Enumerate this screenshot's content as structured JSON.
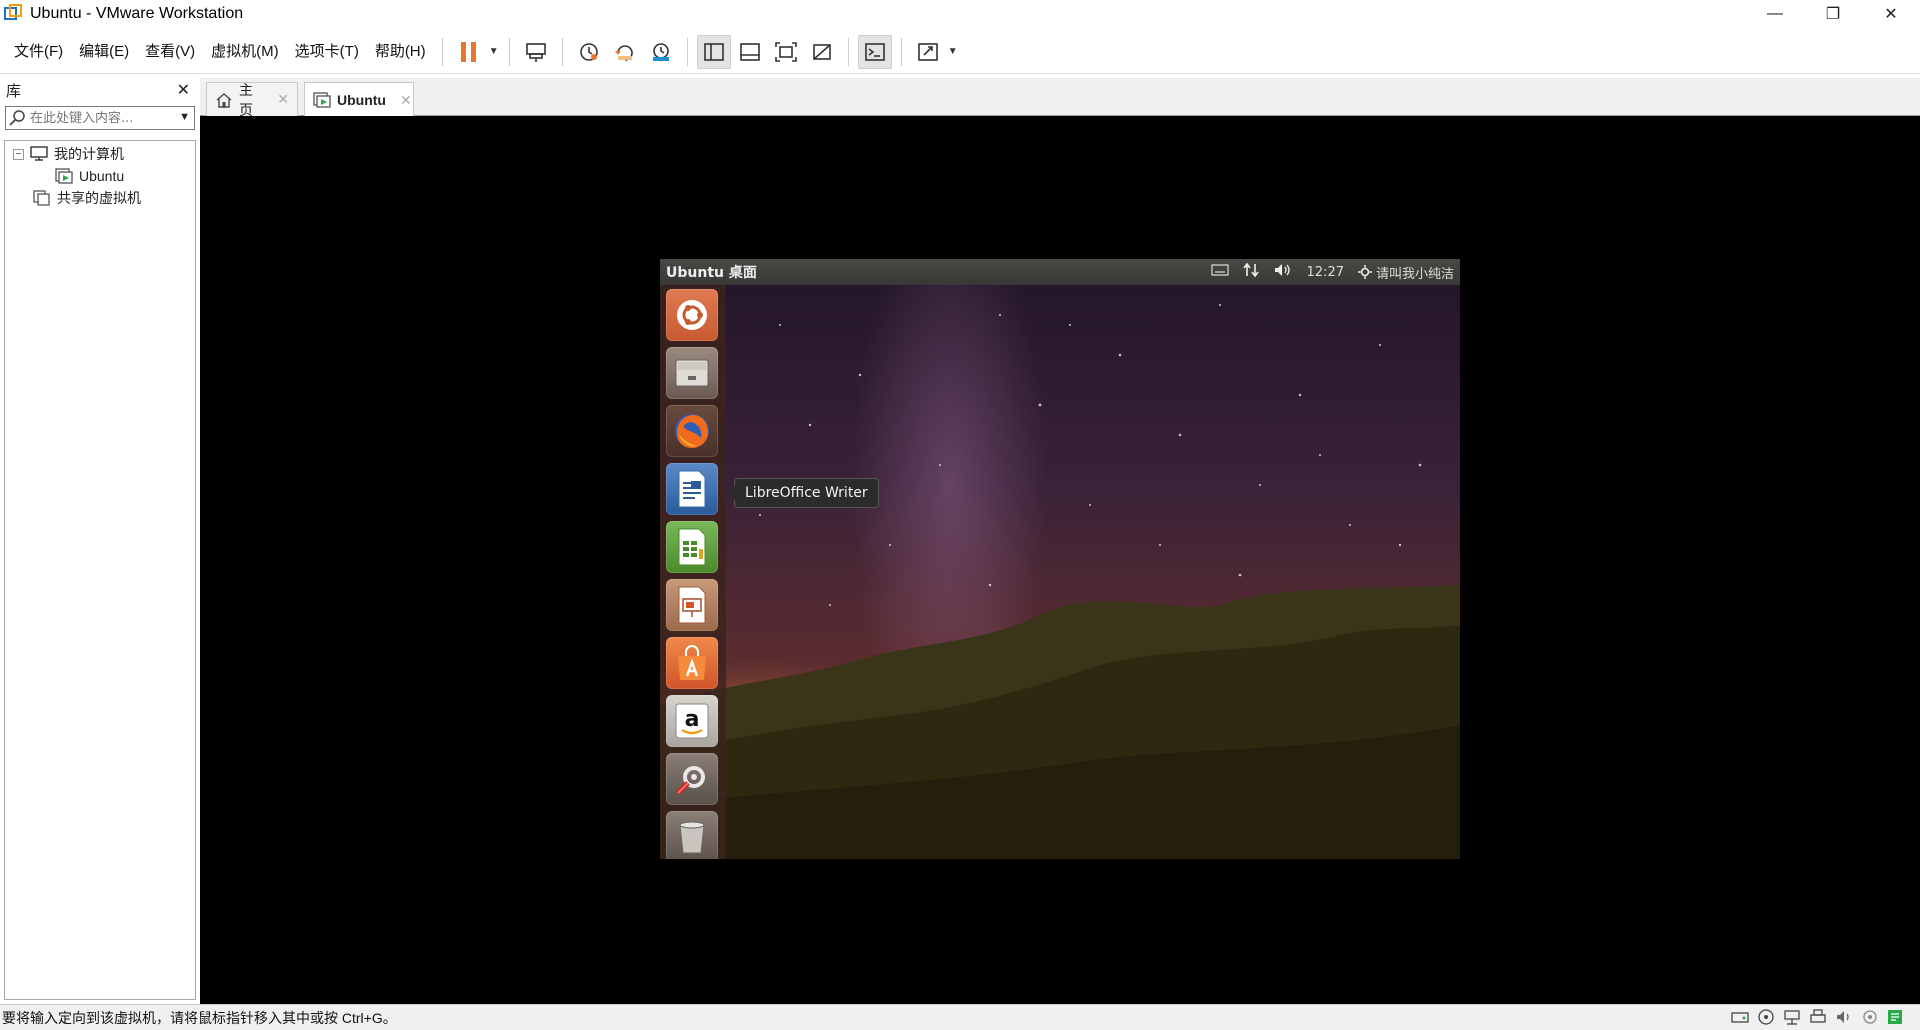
{
  "window": {
    "title": "Ubuntu - VMware Workstation",
    "minimize": "—",
    "restore": "❐",
    "close": "✕"
  },
  "menu": {
    "file": "文件(F)",
    "edit": "编辑(E)",
    "view": "查看(V)",
    "vm": "虚拟机(M)",
    "tabs": "选项卡(T)",
    "help": "帮助(H)"
  },
  "library": {
    "title": "库",
    "close": "✕",
    "search_placeholder": "在此处键入内容...",
    "tree": {
      "my_computer": "我的计算机",
      "ubuntu": "Ubuntu",
      "shared": "共享的虚拟机",
      "expander": "−"
    }
  },
  "tabs": [
    {
      "label": "主页",
      "close": "✕"
    },
    {
      "label": "Ubuntu",
      "close": "✕"
    }
  ],
  "guest": {
    "panel_title": "Ubuntu 桌面",
    "clock": "12:27",
    "user": "请叫我小纯洁",
    "tooltip": "LibreOffice Writer",
    "launcher": [
      "ubuntu-dash",
      "files",
      "firefox",
      "libreoffice-writer",
      "libreoffice-calc",
      "libreoffice-impress",
      "ubuntu-software",
      "amazon",
      "system-settings",
      "trash"
    ]
  },
  "status": {
    "text": "要将输入定向到该虚拟机，请将鼠标指针移入其中或按 Ctrl+G。"
  },
  "colors": {
    "pause_orange": "#e8772e",
    "accent_blue": "#1f6fbf",
    "vm_background": "#000000"
  }
}
